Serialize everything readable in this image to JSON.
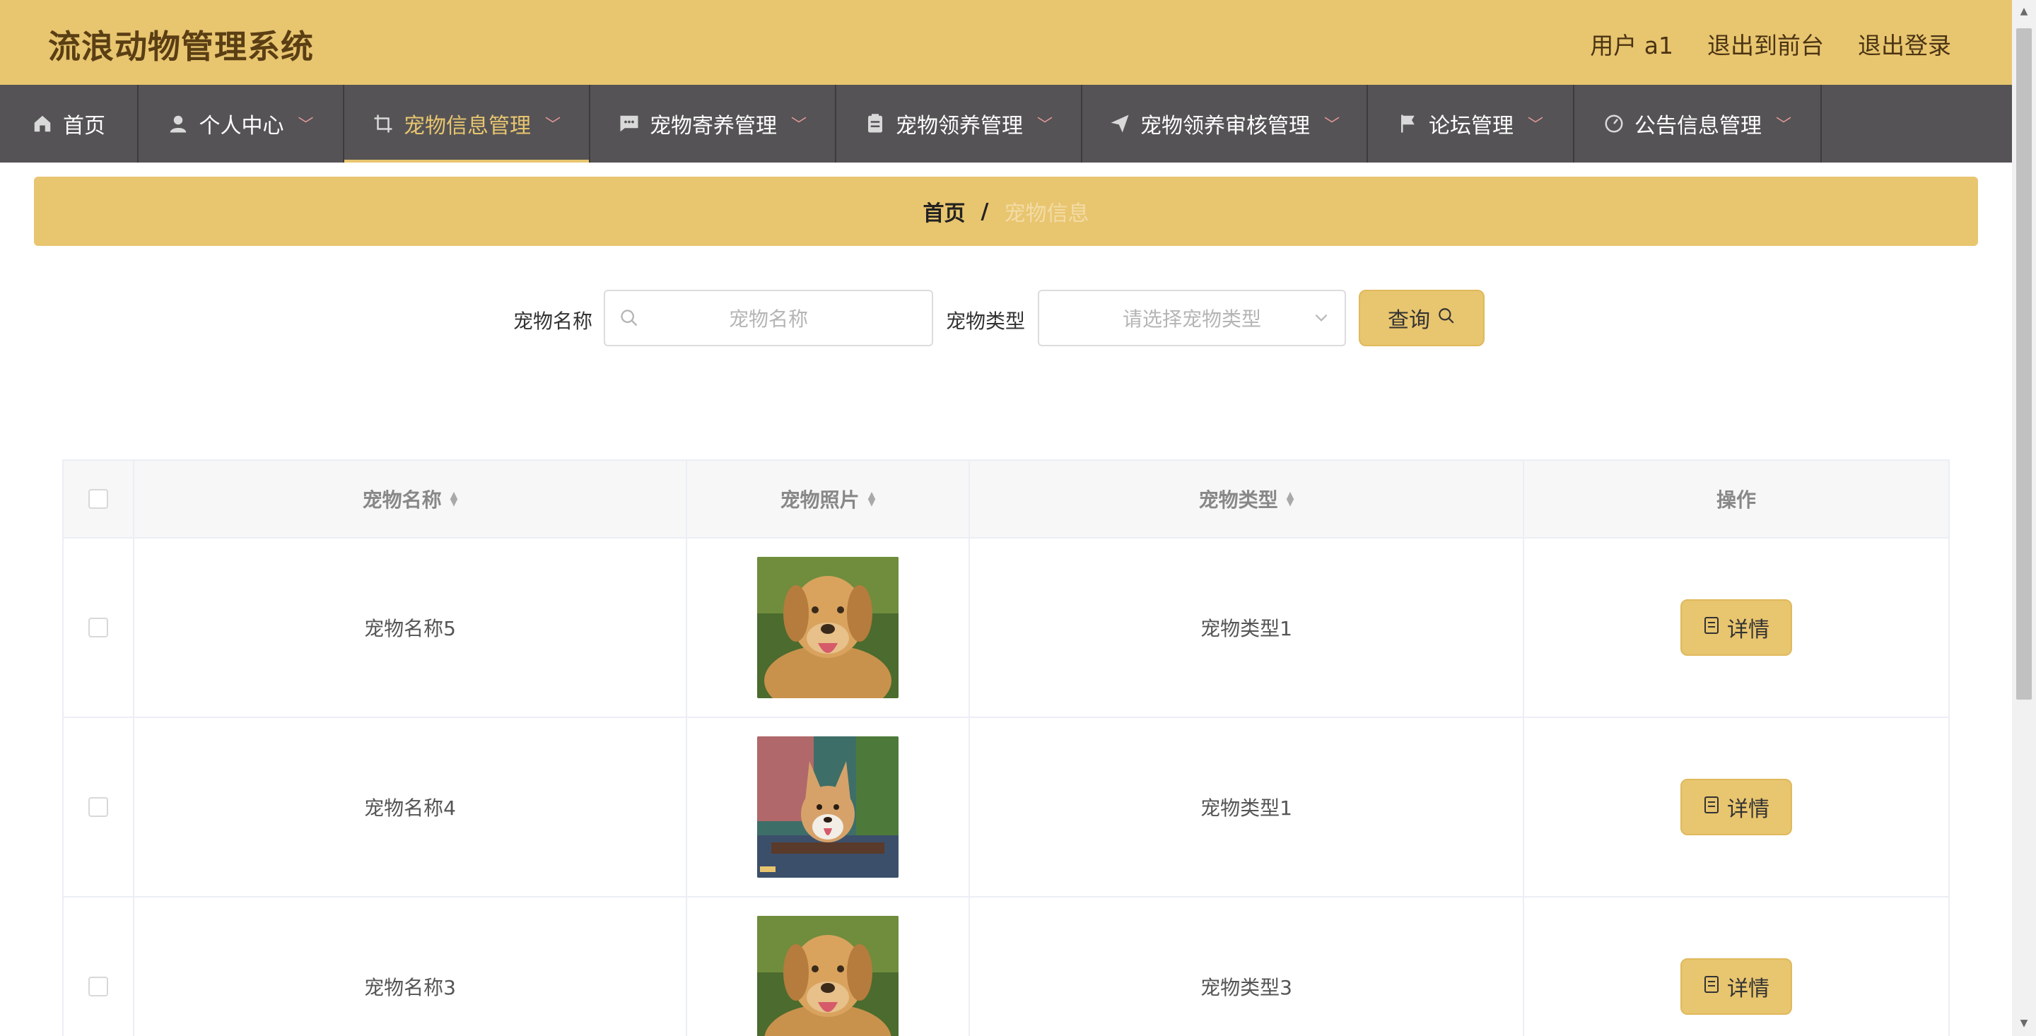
{
  "app": {
    "title": "流浪动物管理系统"
  },
  "header": {
    "user": "用户 a1",
    "to_front": "退出到前台",
    "logout": "退出登录"
  },
  "nav": {
    "items": [
      {
        "label": "首页",
        "icon": "home-icon"
      },
      {
        "label": "个人中心",
        "icon": "user-icon"
      },
      {
        "label": "宠物信息管理",
        "icon": "crop-icon"
      },
      {
        "label": "宠物寄养管理",
        "icon": "chat-icon"
      },
      {
        "label": "宠物领养管理",
        "icon": "clipboard-icon"
      },
      {
        "label": "宠物领养审核管理",
        "icon": "send-icon"
      },
      {
        "label": "论坛管理",
        "icon": "flag-icon"
      },
      {
        "label": "公告信息管理",
        "icon": "gauge-icon"
      }
    ],
    "active_index": 2
  },
  "breadcrumb": {
    "home": "首页",
    "sep": "/",
    "current": "宠物信息"
  },
  "search": {
    "name_label": "宠物名称",
    "name_placeholder": "宠物名称",
    "type_label": "宠物类型",
    "type_placeholder": "请选择宠物类型",
    "query_label": "查询"
  },
  "table": {
    "columns": [
      "宠物名称",
      "宠物照片",
      "宠物类型",
      "操作"
    ],
    "rows": [
      {
        "name": "宠物名称5",
        "photo": "golden-retriever",
        "type": "宠物类型1",
        "action": "详情"
      },
      {
        "name": "宠物名称4",
        "photo": "corgi",
        "type": "宠物类型1",
        "action": "详情"
      },
      {
        "name": "宠物名称3",
        "photo": "golden-retriever",
        "type": "宠物类型3",
        "action": "详情"
      }
    ]
  },
  "colors": {
    "accent": "#e8c56f",
    "nav_bg": "#555355",
    "brand_text": "#5a3e14"
  }
}
